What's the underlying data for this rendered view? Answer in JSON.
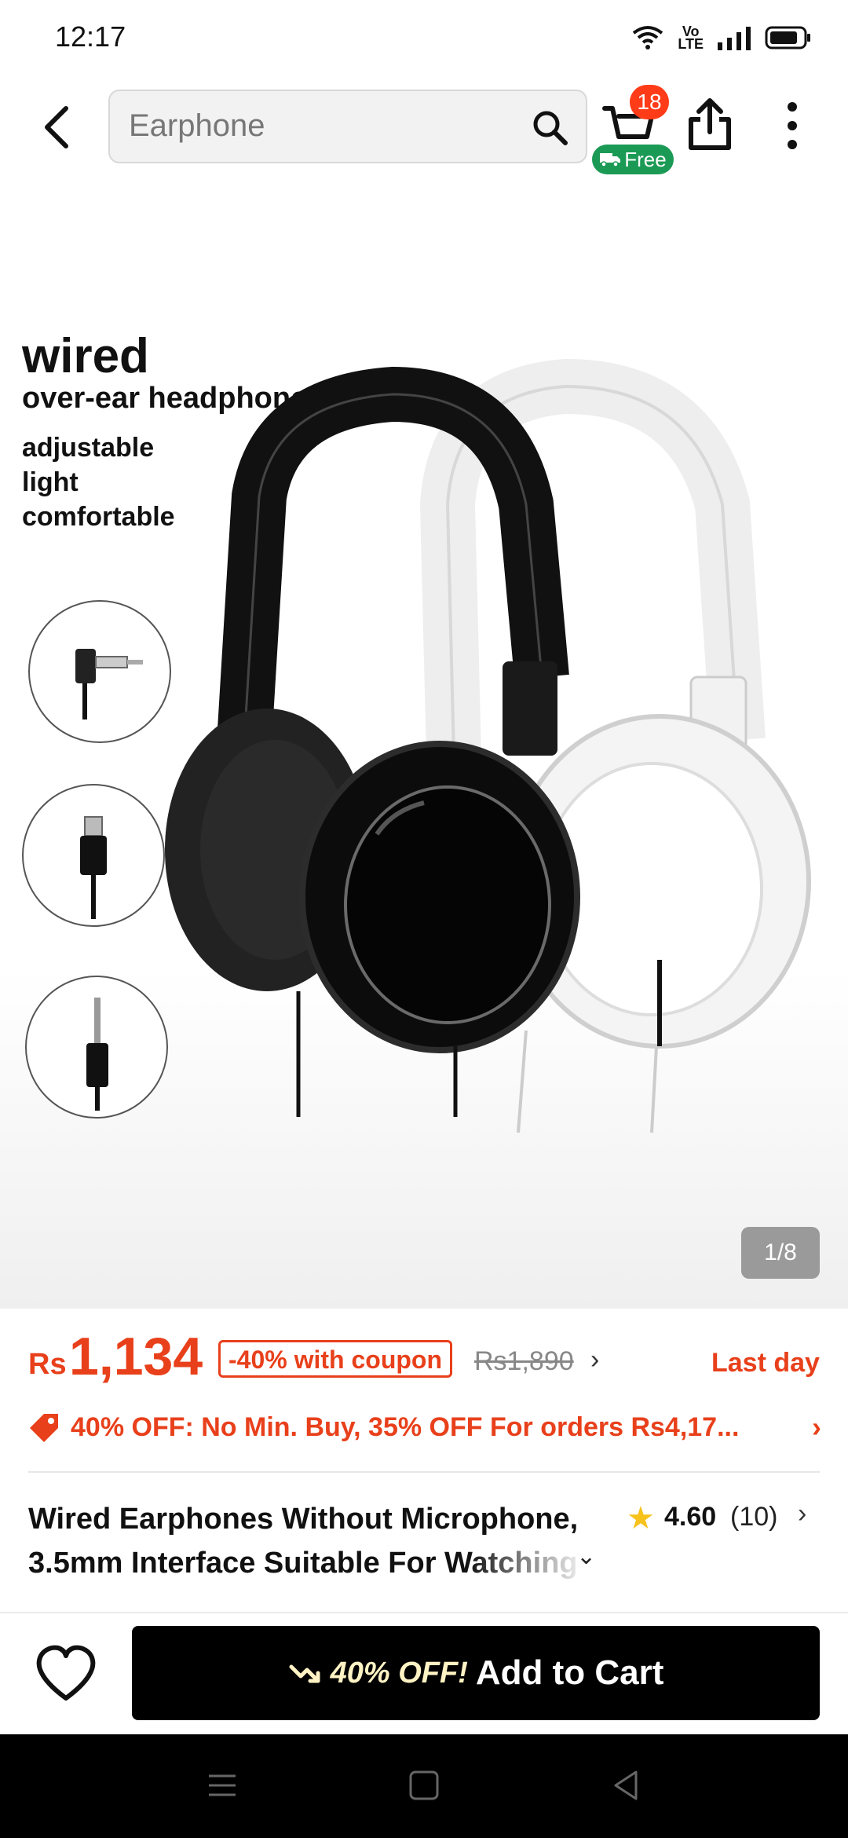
{
  "status": {
    "time": "12:17",
    "network": "Vo LTE"
  },
  "search": {
    "placeholder": "Earphone"
  },
  "cart": {
    "count": "18",
    "free_label": "Free"
  },
  "image": {
    "headline": "wired",
    "subheadline": "over-ear headphones",
    "features": "adjustable\nlight\ncomfortable",
    "counter": "1/8"
  },
  "price": {
    "currency": "Rs",
    "current": "1,134",
    "coupon": "-40% with coupon",
    "original": "Rs1,890",
    "deadline": "Last day"
  },
  "promo": {
    "text": "40% OFF: No Min. Buy,  35% OFF For orders Rs4,17..."
  },
  "product": {
    "title": "Wired Earphones Without Microphone, 3.5mm Interface Suitable For Watching",
    "rating": "4.60",
    "review_count": "(10)"
  },
  "actions": {
    "add_promo": "40% OFF!",
    "add_label": "Add to Cart"
  },
  "colors": {
    "accent": "#e8401b",
    "badge": "#ff3b18",
    "free": "#1b9a55",
    "star": "#f7c21c"
  }
}
